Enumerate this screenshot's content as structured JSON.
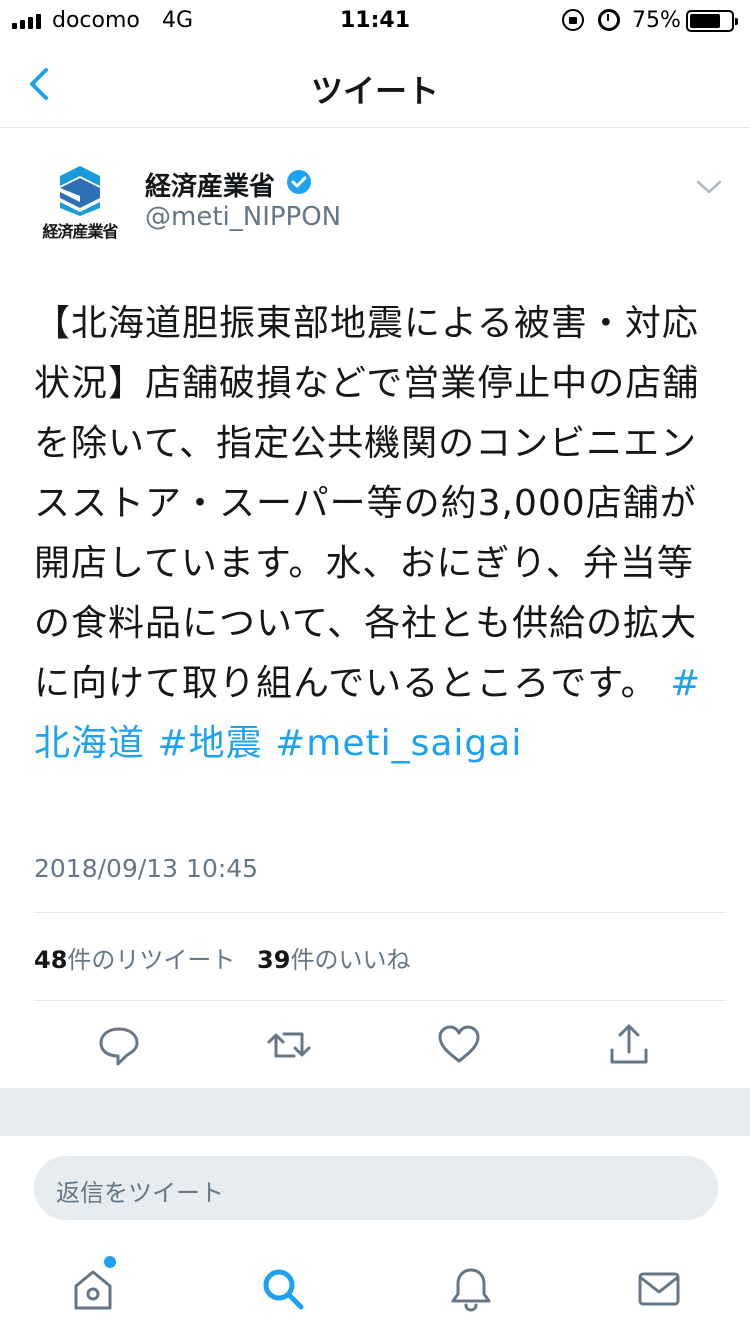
{
  "status_bar": {
    "carrier": "docomo",
    "network": "4G",
    "time": "11:41",
    "battery_percent": "75%",
    "battery_level": 0.75
  },
  "nav": {
    "title": "ツイート",
    "back_icon": "chevron-left-icon"
  },
  "author": {
    "display_name": "経済産業省",
    "handle": "@meti_NIPPON",
    "logo_text": "経済産業省",
    "verified": true
  },
  "tweet": {
    "text": "【北海道胆振東部地震による被害・対応状況】店舗破損などで営業停止中の店舗を除いて、指定公共機関のコンビニエンスストア・スーパー等の約3,000店舗が開店しています。水、おにぎり、弁当等の食料品について、各社とも供給の拡大に向けて取り組んでいるところです。",
    "hashtags": [
      "#北海道",
      "#地震",
      "#meti_saigai"
    ],
    "timestamp": "2018/09/13 10:45"
  },
  "stats": {
    "retweet_count": "48",
    "retweet_label": "件のリツイート",
    "like_count": "39",
    "like_label": "件のいいね"
  },
  "actions": [
    "reply-icon",
    "retweet-icon",
    "like-icon",
    "share-icon"
  ],
  "reply": {
    "placeholder": "返信をツイート"
  },
  "tab_bar": [
    "home-icon",
    "search-icon",
    "notifications-icon",
    "messages-icon"
  ],
  "colors": {
    "accent": "#1da1f2",
    "secondary_text": "#657786",
    "icon_gray": "#657786",
    "band": "#e6ecf0"
  }
}
